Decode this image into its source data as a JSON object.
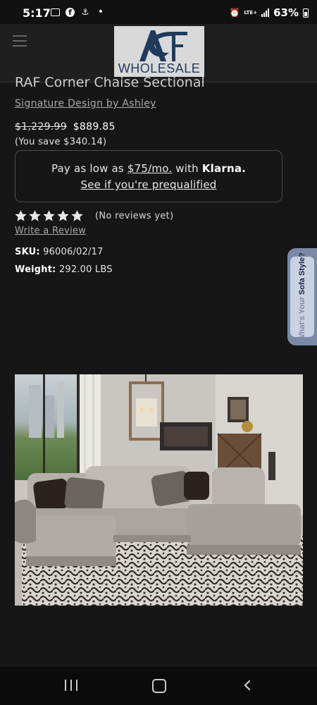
{
  "status_bar": {
    "time": "5:17",
    "left_icons": [
      "image-icon",
      "facebook-icon",
      "anchor-icon",
      "dot-icon"
    ],
    "network": "LTE+",
    "battery": "63%"
  },
  "header": {
    "logo_text": "WHOLESALE",
    "menu_icon": "hamburger-icon"
  },
  "product": {
    "title": "RAF Corner Chaise Sectional",
    "brand": "Signature Design by Ashley",
    "price_original": "$1,229.99",
    "price_sale": "$889.85",
    "savings": "(You save $340.14)",
    "klarna": {
      "prefix": "Pay as low as",
      "amount": "$75/mo.",
      "middle": "with",
      "brand": "Klarna.",
      "link": "See if you're prequalified"
    },
    "rating": {
      "stars": 5,
      "filled": 5,
      "reviews_text": "(No reviews yet)",
      "write_review": "Write a Review"
    },
    "specs": {
      "sku_label": "SKU:",
      "sku_value": "96006/02/17",
      "weight_label": "Weight:",
      "weight_value": "292.00 LBS"
    }
  },
  "side_widget": {
    "question": "What's Your",
    "label": "Sofa Style?"
  },
  "image": {
    "description_icon": "sectional-sofa-photo"
  },
  "nav_bar": {
    "buttons": [
      "recents-icon",
      "home-icon",
      "back-icon"
    ]
  },
  "colors": {
    "background": "#161616",
    "header": "#1f1f1f",
    "text": "#e4e4e4",
    "muted_link": "#aaaaaa",
    "klarna_border": "#4a4a4a",
    "side_widget": "#7a8aa6"
  }
}
